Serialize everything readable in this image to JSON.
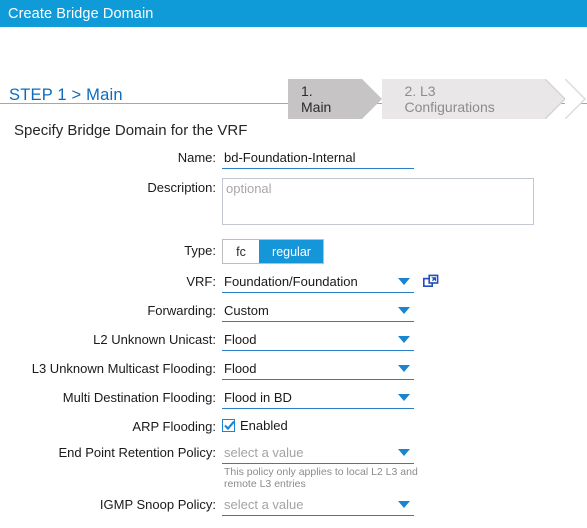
{
  "window": {
    "title": "Create Bridge Domain",
    "titlebar_color": "#0f9bd7"
  },
  "step_header": {
    "step_title": "STEP 1 > Main",
    "step_title_color": "#0b6cbf",
    "steps": [
      {
        "label": "1. Main",
        "state": "active"
      },
      {
        "label": "2. L3 Configurations",
        "state": "inactive"
      }
    ]
  },
  "form": {
    "heading": "Specify Bridge Domain for the VRF",
    "name": {
      "label": "Name:",
      "value": "bd-Foundation-Internal",
      "placeholder": ""
    },
    "description": {
      "label": "Description:",
      "value": "",
      "placeholder": "optional"
    },
    "type": {
      "label": "Type:",
      "options": [
        "fc",
        "regular"
      ],
      "selected": "regular",
      "selected_color": "#1496d8"
    },
    "vrf": {
      "label": "VRF:",
      "value": "Foundation/Foundation",
      "link_icon": "open-in-new-window-icon"
    },
    "forwarding": {
      "label": "Forwarding:",
      "value": "Custom"
    },
    "l2_unknown_unicast": {
      "label": "L2 Unknown Unicast:",
      "value": "Flood"
    },
    "l3_unknown_multicast_flooding": {
      "label": "L3 Unknown Multicast Flooding:",
      "value": "Flood"
    },
    "multi_destination_flooding": {
      "label": "Multi Destination Flooding:",
      "value": "Flood in BD"
    },
    "arp_flooding": {
      "label": "ARP Flooding:",
      "checkbox_label": "Enabled",
      "checked": true
    },
    "end_point_retention_policy": {
      "label": "End Point Retention Policy:",
      "value": "select a value",
      "is_placeholder": true,
      "help": "This policy only applies to local L2 L3 and remote L3 entries"
    },
    "igmp_snoop_policy": {
      "label": "IGMP Snoop Policy:",
      "value": "select a value",
      "is_placeholder": true
    }
  }
}
